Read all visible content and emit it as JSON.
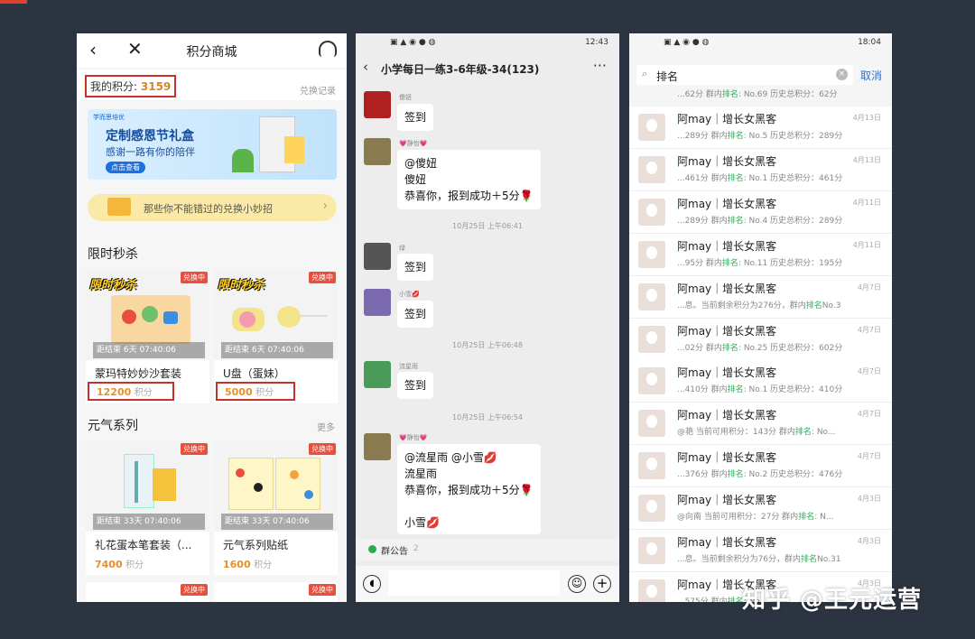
{
  "mall": {
    "title": "积分商城",
    "points_label": "我的积分:",
    "points_value": "3159",
    "redeem_log": "兑换记录",
    "banner": {
      "brand": "学而思培优",
      "title": "定制感恩节礼盒",
      "subtitle": "感谢一路有你的陪伴",
      "button": "点击查看"
    },
    "tips": "那些你不能错过的兑换小妙招",
    "flash_sale": {
      "title": "限时秒杀",
      "logo": "限时秒杀",
      "items": [
        {
          "tag": "兑换中",
          "countdown": "距结束 6天 07:40:06",
          "name": "蒙玛特妙妙沙套装",
          "price": "12200",
          "unit": "积分"
        },
        {
          "tag": "兑换中",
          "countdown": "距结束 6天 07:40:06",
          "name": "U盘（蛋妹）",
          "price": "5000",
          "unit": "积分"
        }
      ]
    },
    "series": {
      "title": "元气系列",
      "more": "更多",
      "items": [
        {
          "tag": "兑换中",
          "countdown": "距结束 33天 07:40:06",
          "name": "礼花蛋本笔套装（...",
          "price": "7400",
          "unit": "积分"
        },
        {
          "tag": "兑换中",
          "countdown": "距结束 33天 07:40:06",
          "name": "元气系列贴纸",
          "price": "1600",
          "unit": "积分"
        }
      ],
      "next_tags": [
        "兑换中",
        "兑换中"
      ]
    }
  },
  "chat": {
    "time": "12:43",
    "title": "小学每日一练3-6年级-34(123)",
    "messages": [
      {
        "sender": "傻妞",
        "lines": [
          "签到"
        ]
      },
      {
        "sender": "💗静怡💗",
        "lines": [
          "@傻妞",
          "傻妞",
          "恭喜你，报到成功＋5分🌹"
        ]
      },
      {
        "timestamp": "10月25日 上午06:41"
      },
      {
        "sender": "绿",
        "lines": [
          "签到"
        ]
      },
      {
        "sender": "小雪💋",
        "lines": [
          "签到"
        ]
      },
      {
        "timestamp": "10月25日 上午06:48"
      },
      {
        "sender": "流星雨",
        "lines": [
          "签到"
        ]
      },
      {
        "timestamp": "10月25日 上午06:54"
      },
      {
        "sender": "💗静怡💗",
        "lines": [
          "@流星雨 @小雪💋",
          "流星雨",
          "恭喜你，报到成功＋5分🌹",
          "",
          "小雪💋"
        ]
      }
    ],
    "notice": "群公告",
    "notice_count": "2"
  },
  "search": {
    "time": "18:04",
    "query": "排名",
    "cancel": "取消",
    "first_sub": {
      "pre": "...62分 群内",
      "hl": "排名",
      "post": ": No.69 历史总积分：62分"
    },
    "results": [
      {
        "name": "阿may｜增长女黑客",
        "date": "4月13日",
        "pre": "...289分 群内",
        "hl": "排名",
        "post": ": No.5 历史总积分：289分"
      },
      {
        "name": "阿may｜增长女黑客",
        "date": "4月13日",
        "pre": "...461分 群内",
        "hl": "排名",
        "post": ": No.1 历史总积分：461分"
      },
      {
        "name": "阿may｜增长女黑客",
        "date": "4月11日",
        "pre": "...289分 群内",
        "hl": "排名",
        "post": ": No.4 历史总积分：289分"
      },
      {
        "name": "阿may｜增长女黑客",
        "date": "4月11日",
        "pre": "...95分 群内",
        "hl": "排名",
        "post": ": No.11 历史总积分：195分"
      },
      {
        "name": "阿may｜增长女黑客",
        "date": "4月7日",
        "pre": "...息。当前剩余积分为276分，群内",
        "hl": "排名",
        "post": "No.3"
      },
      {
        "name": "阿may｜增长女黑客",
        "date": "4月7日",
        "pre": "...02分 群内",
        "hl": "排名",
        "post": ": No.25 历史总积分：602分"
      },
      {
        "name": "阿may｜增长女黑客",
        "date": "4月7日",
        "pre": "...410分 群内",
        "hl": "排名",
        "post": ": No.1 历史总积分：410分"
      },
      {
        "name": "阿may｜增长女黑客",
        "date": "4月7日",
        "pre": "@艳 当前可用积分：143分 群内",
        "hl": "排名",
        "post": ": No..."
      },
      {
        "name": "阿may｜增长女黑客",
        "date": "4月7日",
        "pre": "...376分 群内",
        "hl": "排名",
        "post": ": No.2 历史总积分：476分"
      },
      {
        "name": "阿may｜增长女黑客",
        "date": "4月3日",
        "pre": "@向南 当前可用积分：27分 群内",
        "hl": "排名",
        "post": ": N..."
      },
      {
        "name": "阿may｜增长女黑客",
        "date": "4月3日",
        "pre": "...息。当前剩余积分为76分，群内",
        "hl": "排名",
        "post": "No.31"
      },
      {
        "name": "阿may｜增长女黑客",
        "date": "4月3日",
        "pre": "...575分 群内",
        "hl": "排名",
        "post": ": No..."
      }
    ]
  },
  "watermark": "知乎 @王元运营",
  "colors": {
    "background": "#2b3440",
    "accent_red": "#c9302c",
    "points_orange": "#e8902a",
    "highlight_green": "#2fae5a",
    "link_blue": "#2a6fd1"
  }
}
